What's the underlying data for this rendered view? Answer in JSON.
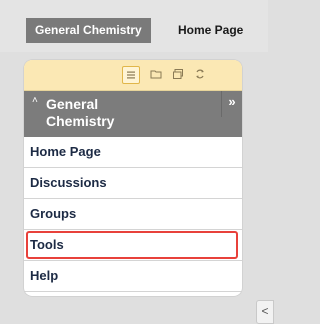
{
  "breadcrumb": {
    "course": "General Chemistry",
    "page": "Home Page"
  },
  "toolbar": {
    "icons": [
      "list-view-icon",
      "folder-icon",
      "window-icon",
      "refresh-icon"
    ]
  },
  "course_menu": {
    "title": "General Chemistry",
    "collapse_arrow": "»",
    "caret": "˄",
    "items": [
      {
        "label": "Home Page",
        "highlighted": false
      },
      {
        "label": "Discussions",
        "highlighted": false
      },
      {
        "label": "Groups",
        "highlighted": false
      },
      {
        "label": "Tools",
        "highlighted": true
      },
      {
        "label": "Help",
        "highlighted": false
      }
    ]
  },
  "colors": {
    "header_bg": "#7c7c7c",
    "toolbar_bg": "#fbe8b4",
    "highlight_border": "#e8413b",
    "link_text": "#1c2a44"
  },
  "scroll_handle": "<"
}
